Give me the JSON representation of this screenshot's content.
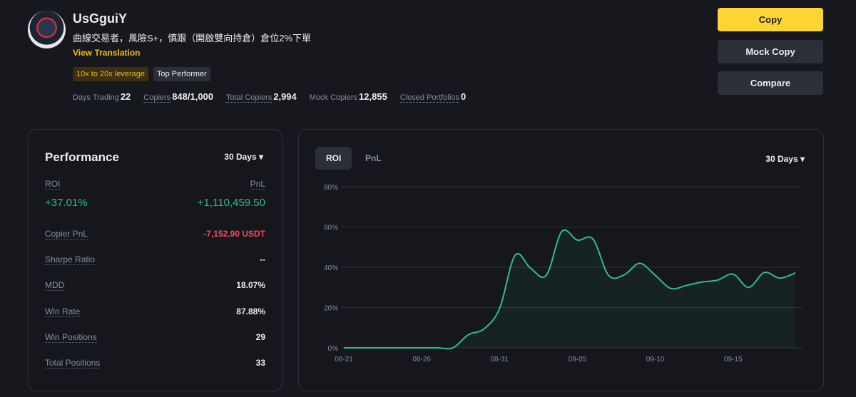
{
  "profile": {
    "name": "UsGguiY",
    "bio": "曲線交易者，風險S+，慎跟（開啟雙向持倉）倉位2%下單",
    "view_translation": "View Translation",
    "tags": [
      "10x to 20x leverage",
      "Top Performer"
    ],
    "stats": [
      {
        "label": "Days Trading",
        "value": "22"
      },
      {
        "label": "Copiers",
        "value": "848/1,000"
      },
      {
        "label": "Total Copiers",
        "value": "2,994"
      },
      {
        "label": "Mock Copiers",
        "value": "12,855"
      },
      {
        "label": "Closed Portfolios",
        "value": "0"
      }
    ]
  },
  "actions": {
    "copy": "Copy",
    "mock_copy": "Mock Copy",
    "compare": "Compare"
  },
  "performance": {
    "title": "Performance",
    "period": "30 Days ▾",
    "roi_label": "ROI",
    "pnl_label": "PnL",
    "roi": "+37.01%",
    "pnl": "+1,110,459.50",
    "rows": [
      {
        "label": "Copier PnL",
        "value": "-7,152.90 USDT"
      },
      {
        "label": "Sharpe Ratio",
        "value": "--"
      },
      {
        "label": "MDD",
        "value": "18.07%"
      },
      {
        "label": "Win Rate",
        "value": "87.88%"
      },
      {
        "label": "Win Positions",
        "value": "29"
      },
      {
        "label": "Total Positions",
        "value": "33"
      }
    ]
  },
  "chart_panel": {
    "tabs": [
      "ROI",
      "PnL"
    ],
    "period": "30 Days ▾"
  },
  "chart_data": {
    "type": "area",
    "title": "",
    "xlabel": "",
    "ylabel": "ROI",
    "ylim": [
      0,
      80
    ],
    "yticks": [
      "0%",
      "20%",
      "40%",
      "60%",
      "80%"
    ],
    "xticks": [
      "08-21",
      "08-26",
      "08-31",
      "09-05",
      "09-10",
      "09-15"
    ],
    "x": [
      "08-21",
      "08-22",
      "08-23",
      "08-24",
      "08-25",
      "08-26",
      "08-27",
      "08-28",
      "08-29",
      "08-30",
      "08-31",
      "09-01",
      "09-02",
      "09-03",
      "09-04",
      "09-05",
      "09-06",
      "09-07",
      "09-08",
      "09-09",
      "09-10",
      "09-11",
      "09-12",
      "09-13",
      "09-14",
      "09-15",
      "09-16",
      "09-17",
      "09-18",
      "09-19"
    ],
    "series": [
      {
        "name": "ROI",
        "color": "#2ebd85",
        "values": [
          0,
          0,
          0,
          0,
          0,
          0,
          0,
          0,
          6.5,
          9.4,
          19.5,
          46,
          39.5,
          36,
          57.8,
          53.5,
          54,
          36,
          36.2,
          42,
          36,
          29.5,
          31,
          32.7,
          33.6,
          36.6,
          30,
          37.4,
          34.6,
          37.2
        ]
      }
    ]
  }
}
